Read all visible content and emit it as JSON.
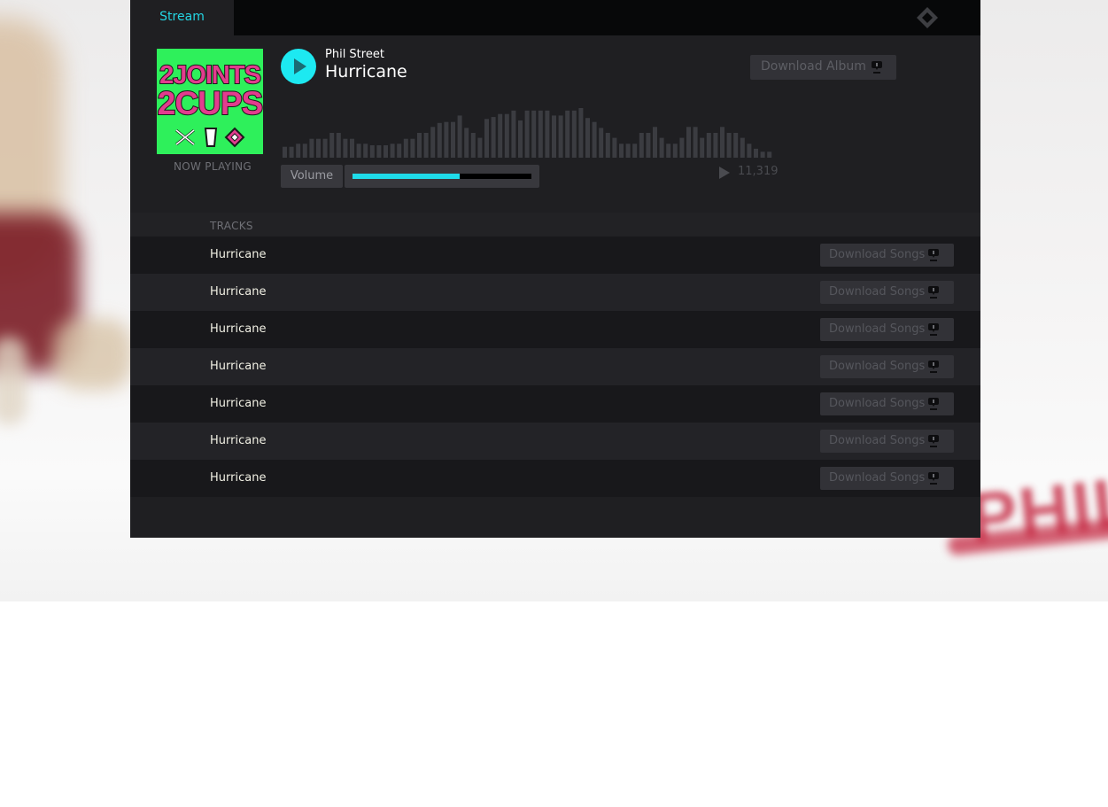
{
  "topbar": {
    "tab_label": "Stream",
    "logo_icon": "diamond-logo-icon"
  },
  "now_playing": {
    "cover_text_line1": "2JOINTS",
    "cover_text_line2": "2CUPS",
    "status_label": "NOW PLAYING",
    "artist": "Phil Street",
    "title": "Hurricane",
    "play_icon": "play-icon"
  },
  "album_download": {
    "label": "Download Album",
    "icon": "download-icon"
  },
  "volume": {
    "label": "Volume",
    "level": 0.6
  },
  "plays": {
    "icon": "play-count-icon",
    "count": "11,319"
  },
  "waveform": {
    "levels": [
      0.22,
      0.22,
      0.28,
      0.28,
      0.38,
      0.38,
      0.38,
      0.5,
      0.5,
      0.38,
      0.38,
      0.28,
      0.28,
      0.25,
      0.25,
      0.25,
      0.28,
      0.28,
      0.38,
      0.38,
      0.5,
      0.5,
      0.62,
      0.7,
      0.72,
      0.72,
      0.85,
      0.6,
      0.5,
      0.4,
      0.78,
      0.82,
      0.88,
      0.88,
      0.95,
      0.75,
      0.95,
      0.95,
      0.95,
      0.95,
      0.85,
      0.85,
      0.95,
      0.95,
      1.0,
      0.8,
      0.72,
      0.6,
      0.5,
      0.4,
      0.28,
      0.28,
      0.28,
      0.5,
      0.5,
      0.62,
      0.4,
      0.28,
      0.28,
      0.4,
      0.62,
      0.62,
      0.4,
      0.5,
      0.5,
      0.62,
      0.5,
      0.5,
      0.4,
      0.28,
      0.18,
      0.12,
      0.12
    ]
  },
  "tracks": {
    "header": "TRACKS",
    "download_label": "Download Songs",
    "download_icon": "download-icon",
    "items": [
      {
        "name": "Hurricane"
      },
      {
        "name": "Hurricane"
      },
      {
        "name": "Hurricane"
      },
      {
        "name": "Hurricane"
      },
      {
        "name": "Hurricane"
      },
      {
        "name": "Hurricane"
      },
      {
        "name": "Hurricane"
      }
    ]
  },
  "colors": {
    "accent": "#1de9f1",
    "panel": "#1f1f22",
    "topbar": "#070809",
    "cover_green": "#2ef05b",
    "cover_pink": "#e23c8e"
  }
}
